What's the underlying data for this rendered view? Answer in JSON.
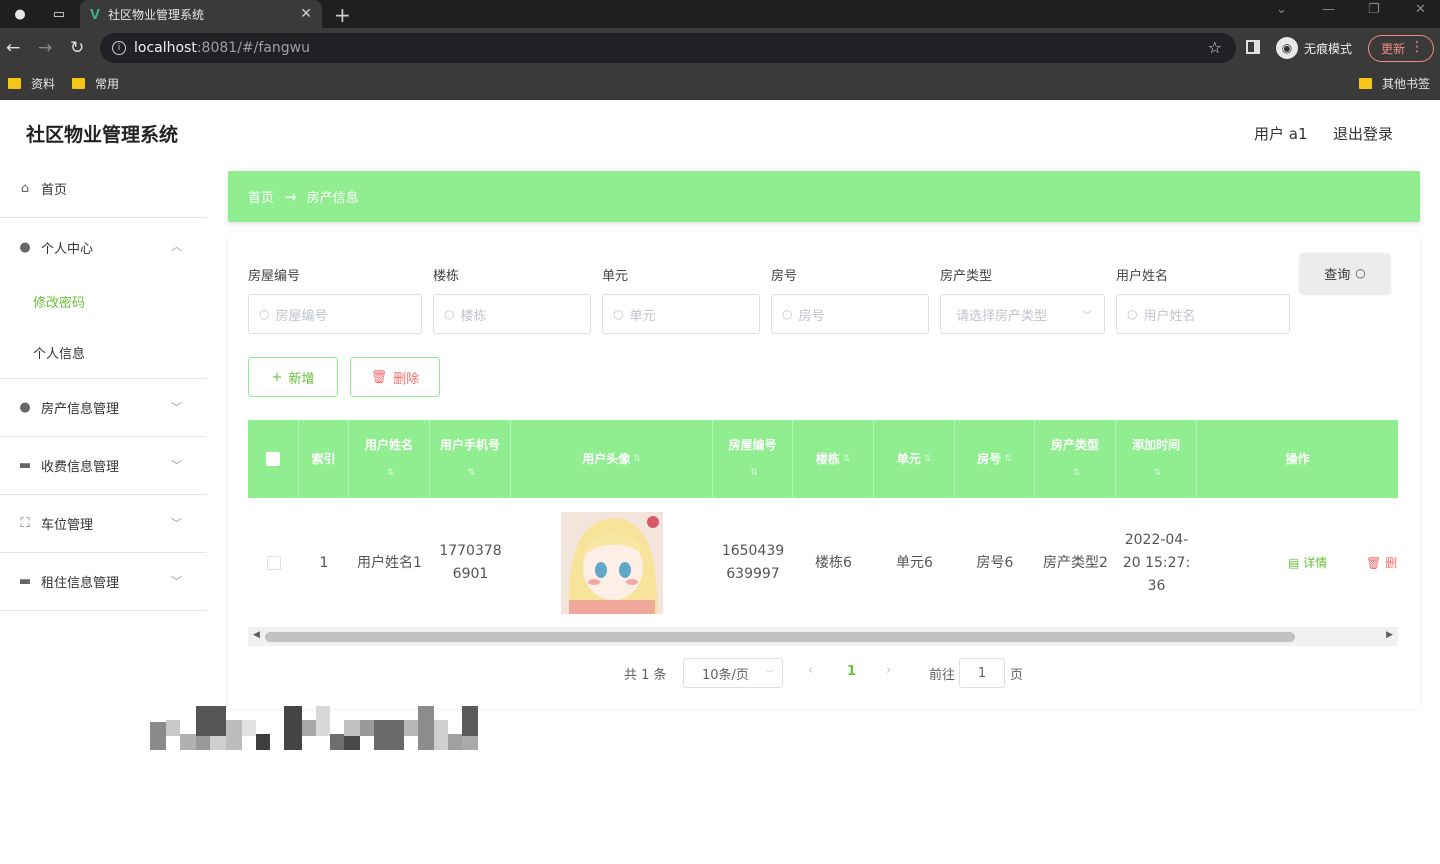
{
  "browser": {
    "tab_title": "社区物业管理系统",
    "tab_favicon": "V",
    "url_host": "localhost",
    "url_rest": ":8081/#/fangwu",
    "incognito_label": "无痕模式",
    "update_label": "更新",
    "bookmarks": [
      "资料",
      "常用"
    ],
    "other_bookmarks": "其他书签"
  },
  "header": {
    "title": "社区物业管理系统",
    "user": "用户 a1",
    "logout": "退出登录"
  },
  "sidebar": {
    "home": "首页",
    "personal_center": "个人中心",
    "change_password": "修改密码",
    "personal_info": "个人信息",
    "property_mgmt": "房产信息管理",
    "fee_mgmt": "收费信息管理",
    "parking_mgmt": "车位管理",
    "rental_mgmt": "租住信息管理"
  },
  "breadcrumb": {
    "home": "首页",
    "arrow": "→",
    "current": "房产信息"
  },
  "filters": {
    "house_no_label": "房屋编号",
    "house_no_placeholder": "房屋编号",
    "building_label": "楼栋",
    "building_placeholder": "楼栋",
    "unit_label": "单元",
    "unit_placeholder": "单元",
    "room_label": "房号",
    "room_placeholder": "房号",
    "type_label": "房产类型",
    "type_placeholder": "请选择房产类型",
    "username_label": "用户姓名",
    "username_placeholder": "用户姓名",
    "query_btn": "查询"
  },
  "actions": {
    "add": "新增",
    "delete": "删除"
  },
  "table": {
    "headers": {
      "index": "索引",
      "username": "用户姓名",
      "phone": "用户手机号",
      "avatar": "用户头像",
      "house_no": "房屋编号",
      "building": "楼栋",
      "unit": "单元",
      "room": "房号",
      "type": "房产类型",
      "added": "添加时间",
      "ops": "操作"
    },
    "rows": [
      {
        "index": "1",
        "username": "用户姓名1",
        "phone": "17703786901",
        "house_no": "1650439639997",
        "building": "楼栋6",
        "unit": "单元6",
        "room": "房号6",
        "type": "房产类型2",
        "added": "2022-04-20 15:27:36",
        "detail": "详情",
        "delete": "删"
      }
    ]
  },
  "pagination": {
    "total": "共 1 条",
    "page_size": "10条/页",
    "current": "1",
    "goto": "前往",
    "goto_value": "1",
    "page_suffix": "页"
  },
  "colors": {
    "accent": "#90ee90",
    "active_text": "#67c23a",
    "danger": "#f56c6c"
  }
}
